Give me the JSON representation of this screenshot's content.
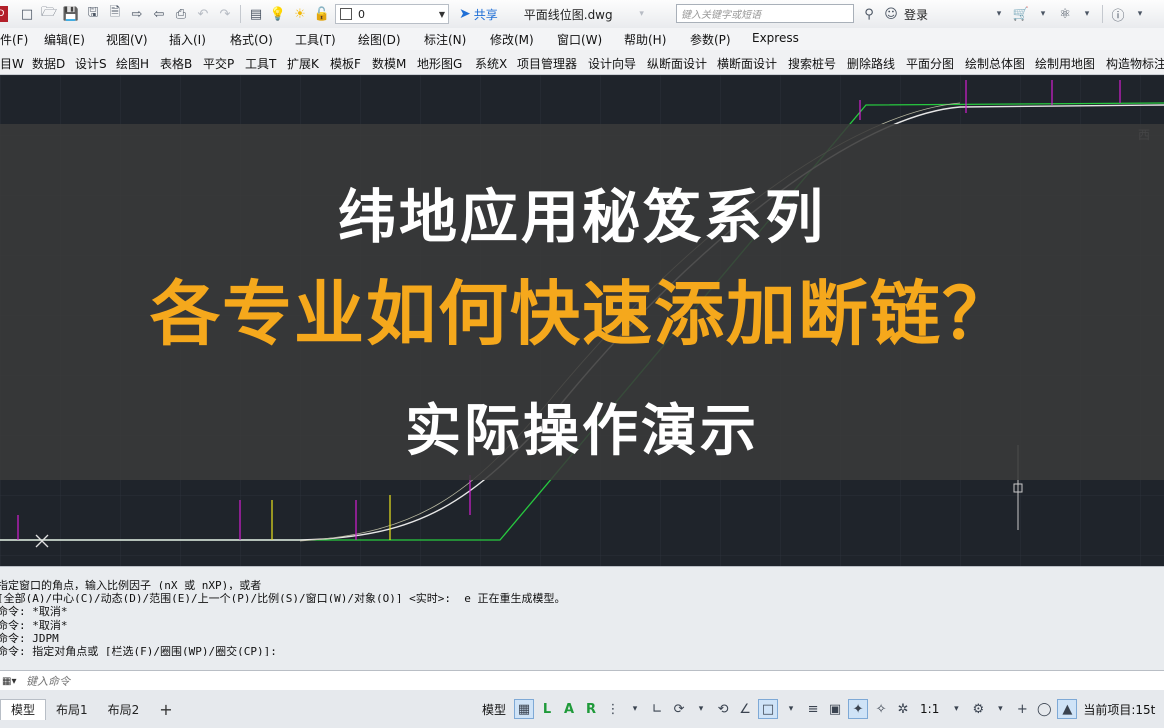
{
  "app": {
    "file_name": "平面线位图.dwg",
    "share_label": "共享"
  },
  "quick_toolbar": {
    "layer_value": "0",
    "search_placeholder": "键入关键字或短语",
    "login_label": "登录"
  },
  "menu": [
    "件(F)",
    "编辑(E)",
    "视图(V)",
    "插入(I)",
    "格式(O)",
    "工具(T)",
    "绘图(D)",
    "标注(N)",
    "修改(M)",
    "窗口(W)",
    "帮助(H)",
    "参数(P)",
    "Express"
  ],
  "toolbar2": [
    {
      "text": "目W"
    },
    {
      "text": "数据D"
    },
    {
      "text": "设计S"
    },
    {
      "text": "绘图H"
    },
    {
      "text": "表格B"
    },
    {
      "text": "平交P"
    },
    {
      "text": "工具T"
    },
    {
      "text": "扩展K"
    },
    {
      "text": "模板F"
    },
    {
      "text": "数模M"
    },
    {
      "text": "地形图G"
    },
    {
      "text": "系统X"
    },
    {
      "text": "项目管理器"
    },
    {
      "text": "设计向导"
    },
    {
      "text": "纵断面设计"
    },
    {
      "text": "横断面设计"
    },
    {
      "text": "搜索桩号"
    },
    {
      "text": "删除路线"
    },
    {
      "text": "平面分图"
    },
    {
      "text": "绘制总体图"
    },
    {
      "text": "绘制用地图"
    },
    {
      "text": "构造物标注"
    }
  ],
  "canvas": {
    "compass_label": "西",
    "title_line1": "纬地应用秘笈系列",
    "title_line2": "各专业如何快速添加断链？",
    "title_line3": "实际操作演示"
  },
  "command_history": [
    "指定窗口的角点，输入比例因子 (nX 或 nXP)，或者",
    "[全部(A)/中心(C)/动态(D)/范围(E)/上一个(P)/比例(S)/窗口(W)/对象(O)] <实时>: _e 正在重生成模型。",
    "命令: *取消*",
    "命令: *取消*",
    "命令: JDPM",
    "命令: 指定对角点或 [栏选(F)/圈围(WP)/圈交(CP)]:"
  ],
  "command_line": {
    "placeholder": "键入命令"
  },
  "status": {
    "tabs": [
      "模型",
      "布局1",
      "布局2"
    ],
    "model_label": "模型",
    "scale_label": "1:1",
    "project_label": "当前项目:15t"
  },
  "colors": {
    "canvas_bg": "#1f242b",
    "grid_major": "#2e3540",
    "road_line": "#e6e6e6",
    "tangent_line": "#27c93f",
    "label_magenta": "#d21fd2",
    "label_yellow": "#e8e21c",
    "subtitle_orange": "#f5a81c"
  }
}
